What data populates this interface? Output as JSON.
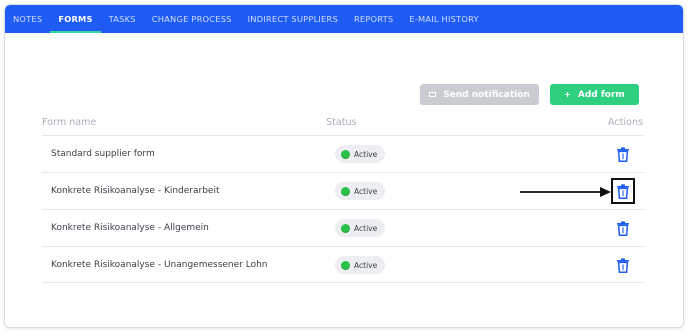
{
  "tabs": [
    {
      "label": "NOTES",
      "active": false
    },
    {
      "label": "FORMS",
      "active": true
    },
    {
      "label": "TASKS",
      "active": false
    },
    {
      "label": "CHANGE PROCESS",
      "active": false
    },
    {
      "label": "INDIRECT SUPPLIERS",
      "active": false
    },
    {
      "label": "REPORTS",
      "active": false
    },
    {
      "label": "E-MAIL HISTORY",
      "active": false
    }
  ],
  "toolbar": {
    "send_label": "Send notification",
    "send_icon": "mail-icon",
    "add_label": "Add form",
    "add_icon": "+"
  },
  "table": {
    "columns": {
      "name": "Form name",
      "status": "Status",
      "actions": "Actions"
    },
    "rows": [
      {
        "name": "Standard supplier form",
        "status": "Active"
      },
      {
        "name": "Konkrete Risikoanalyse - Kinderarbeit",
        "status": "Active"
      },
      {
        "name": "Konkrete Risikoanalyse - Allgemein",
        "status": "Active"
      },
      {
        "name": "Konkrete Risikoanalyse - Unangemessener Lohn",
        "status": "Active"
      }
    ]
  },
  "annotation": {
    "highlighted_row": 1,
    "type": "arrow-and-box",
    "target_icon": "trash-icon"
  },
  "colors": {
    "tabbar": "#1f5cf5",
    "active_tab_underline": "#36d39a",
    "add_button": "#2fcf80",
    "send_button_disabled": "#c9ccd1",
    "status_dot": "#2bc24a",
    "trash_icon": "#1f5cf5"
  }
}
